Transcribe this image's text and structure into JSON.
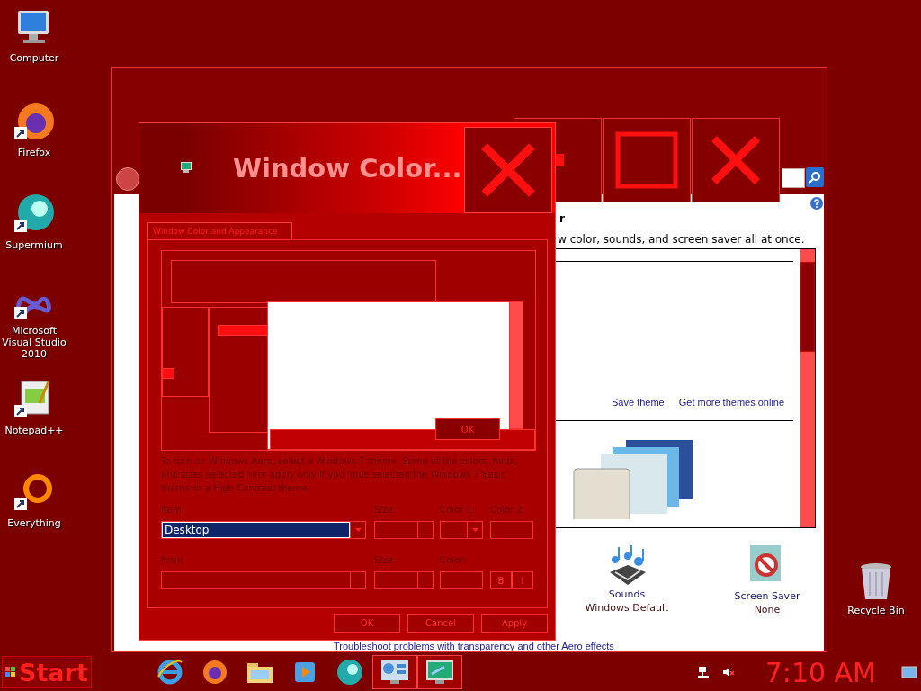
{
  "desktop_icons": [
    {
      "label": "Computer",
      "kind": "computer"
    },
    {
      "label": "Firefox",
      "kind": "firefox"
    },
    {
      "label": "Supermium",
      "kind": "supermium"
    },
    {
      "label": "Microsoft Visual Studio 2010",
      "kind": "vs"
    },
    {
      "label": "Notepad++",
      "kind": "notepad"
    },
    {
      "label": "Everything",
      "kind": "everything"
    }
  ],
  "recycle_bin": {
    "label": "Recycle Bin"
  },
  "back_window": {
    "heading": "r",
    "subtitle": "w color, sounds, and screen saver all at once.",
    "theme_links": [
      "Save theme",
      "Get more themes online"
    ],
    "settings": [
      {
        "label": "Sounds",
        "value": "Windows Default",
        "kind": "sounds"
      },
      {
        "label": "Screen Saver",
        "value": "None",
        "kind": "screensaver"
      }
    ],
    "bottom_link": "Troubleshoot problems with transparency and other Aero effects"
  },
  "dialog": {
    "title": "Window Color...",
    "tab": {
      "label": "Window Color and Appearance",
      "selected": true
    },
    "preview_button": "OK",
    "description": "To turn on Windows Aero, select a Windows 7 theme. Some of the colors, fonts, and sizes selected here apply only if you have selected the Windows 7 Basic theme or a High Contrast theme.",
    "item": {
      "label": "Item:",
      "value": "Desktop"
    },
    "item_size": {
      "label": "Size:"
    },
    "color1": {
      "label": "Color 1:"
    },
    "color2": {
      "label": "Color 2:"
    },
    "font": {
      "label": "Font:"
    },
    "font_size": {
      "label": "Size:"
    },
    "font_color": {
      "label": "Color:"
    },
    "bold": "B",
    "italic": "I",
    "buttons": [
      "OK",
      "Cancel",
      "Apply"
    ]
  },
  "taskbar": {
    "start": "Start",
    "apps": [
      {
        "kind": "ie",
        "active": false
      },
      {
        "kind": "firefox",
        "active": false
      },
      {
        "kind": "folder",
        "active": false
      },
      {
        "kind": "media",
        "active": false
      },
      {
        "kind": "supermium",
        "active": false
      },
      {
        "kind": "control",
        "active": true
      },
      {
        "kind": "display",
        "active": true
      }
    ],
    "clock": "7:10 AM"
  }
}
